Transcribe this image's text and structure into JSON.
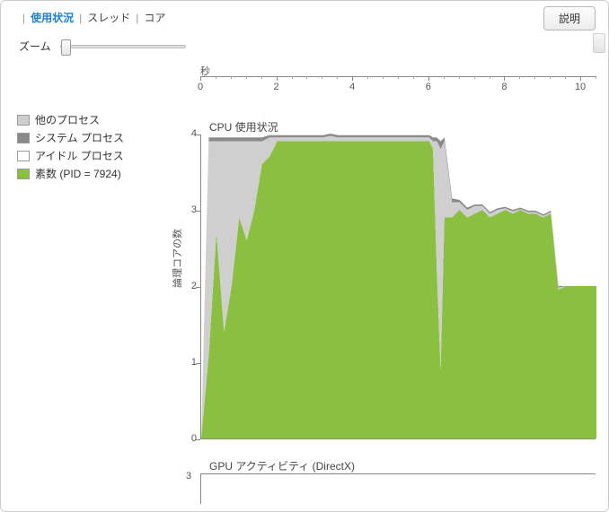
{
  "tabs": {
    "usage": "使用状況",
    "threads": "スレッド",
    "cores": "コア",
    "sep": "|"
  },
  "help_button": "説明",
  "zoom_label": "ズーム",
  "seconds_label": "秒",
  "legend": {
    "other": {
      "label": "他のプロセス",
      "color": "#cfcfcf"
    },
    "system": {
      "label": "システム プロセス",
      "color": "#8a8a8a"
    },
    "idle": {
      "label": "アイドル プロセス",
      "color": "#ffffff"
    },
    "app": {
      "label": "素数 (PID = 7924)",
      "color": "#8bbf3f"
    }
  },
  "cpu_title": "CPU 使用状況",
  "yaxis_label": "論理コアの数",
  "gpu_title": "GPU アクティビティ (DirectX)",
  "gpu_ymax": "3",
  "chart_data": {
    "type": "area",
    "title": "CPU 使用状況",
    "xlabel": "秒",
    "ylabel": "論理コアの数",
    "xlim": [
      0,
      10.4
    ],
    "ylim": [
      0,
      4
    ],
    "x_ticks": [
      0,
      2,
      4,
      6,
      8,
      10
    ],
    "y_ticks": [
      0,
      1,
      2,
      3,
      4
    ],
    "x": [
      0,
      0.2,
      0.4,
      0.6,
      0.8,
      1.0,
      1.2,
      1.4,
      1.6,
      1.8,
      2.0,
      2.2,
      2.4,
      2.6,
      2.8,
      3.0,
      3.2,
      3.4,
      3.6,
      3.8,
      4.0,
      4.2,
      4.4,
      4.6,
      4.8,
      5.0,
      5.2,
      5.4,
      5.6,
      5.8,
      6.0,
      6.1,
      6.2,
      6.3,
      6.4,
      6.6,
      6.8,
      7.0,
      7.2,
      7.4,
      7.6,
      7.8,
      8.0,
      8.2,
      8.4,
      8.6,
      8.8,
      9.0,
      9.2,
      9.4,
      9.6,
      9.8,
      10.0,
      10.2,
      10.4
    ],
    "series": [
      {
        "name": "素数 (PID = 7924)",
        "color": "#8bbf3f",
        "values": [
          0,
          1.1,
          2.7,
          1.4,
          2.0,
          2.9,
          2.6,
          3.0,
          3.6,
          3.7,
          3.9,
          3.9,
          3.9,
          3.9,
          3.9,
          3.9,
          3.9,
          3.9,
          3.9,
          3.9,
          3.9,
          3.9,
          3.9,
          3.9,
          3.9,
          3.9,
          3.9,
          3.9,
          3.9,
          3.9,
          3.9,
          3.8,
          2.2,
          0.9,
          2.9,
          2.9,
          3.0,
          2.9,
          2.95,
          3.0,
          2.9,
          2.95,
          3.0,
          2.95,
          3.0,
          2.95,
          2.95,
          2.9,
          2.95,
          1.95,
          2.0,
          2.0,
          2.0,
          2.0,
          2.0
        ]
      },
      {
        "name": "他のプロセス",
        "color": "#cfcfcf",
        "values": [
          0,
          2.8,
          1.2,
          2.5,
          1.9,
          1.0,
          1.3,
          0.9,
          0.3,
          0.25,
          0.05,
          0.05,
          0.05,
          0.05,
          0.05,
          0.05,
          0.05,
          0.07,
          0.05,
          0.05,
          0.05,
          0.05,
          0.05,
          0.05,
          0.05,
          0.05,
          0.05,
          0.05,
          0.05,
          0.05,
          0.05,
          0.1,
          1.7,
          2.9,
          1.0,
          0.2,
          0.1,
          0.1,
          0.1,
          0.05,
          0.05,
          0.05,
          0.02,
          0.03,
          0.01,
          0.02,
          0.02,
          0.02,
          0.02,
          0.03,
          0.0,
          0.0,
          0.0,
          0.0,
          0.0
        ]
      },
      {
        "name": "システム プロセス",
        "color": "#8a8a8a",
        "values": [
          0,
          0.05,
          0.05,
          0.05,
          0.05,
          0.05,
          0.05,
          0.05,
          0.05,
          0.03,
          0.03,
          0.03,
          0.03,
          0.03,
          0.03,
          0.03,
          0.03,
          0.03,
          0.03,
          0.03,
          0.03,
          0.03,
          0.03,
          0.03,
          0.03,
          0.03,
          0.03,
          0.03,
          0.03,
          0.03,
          0.03,
          0.05,
          0.05,
          0.1,
          0.05,
          0.05,
          0.03,
          0.03,
          0.02,
          0.02,
          0.02,
          0.02,
          0.02,
          0.02,
          0.02,
          0.02,
          0.02,
          0.02,
          0.02,
          0.02,
          0.0,
          0.0,
          0.0,
          0.0,
          0.0
        ]
      }
    ]
  }
}
